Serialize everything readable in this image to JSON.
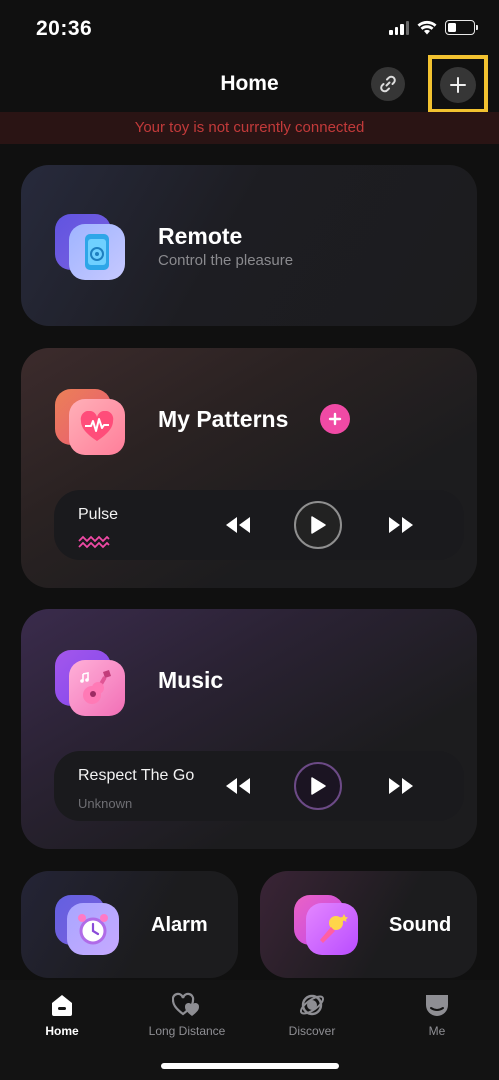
{
  "status_bar": {
    "time": "20:36"
  },
  "header": {
    "title": "Home"
  },
  "banner": {
    "text": "Your toy is not currently connected"
  },
  "cards": {
    "remote": {
      "title": "Remote",
      "subtitle": "Control the pleasure"
    },
    "patterns": {
      "title": "My Patterns",
      "player": {
        "track": "Pulse"
      }
    },
    "music": {
      "title": "Music",
      "player": {
        "track": "Respect The Go",
        "artist": "Unknown"
      }
    },
    "alarm": {
      "title": "Alarm"
    },
    "sound": {
      "title": "Sound"
    }
  },
  "tabbar": {
    "items": [
      {
        "label": "Home",
        "icon": "home-icon",
        "active": true
      },
      {
        "label": "Long Distance",
        "icon": "hearts-icon",
        "active": false
      },
      {
        "label": "Discover",
        "icon": "planet-icon",
        "active": false
      },
      {
        "label": "Me",
        "icon": "face-icon",
        "active": false
      }
    ]
  },
  "colors": {
    "accent_pink": "#f04aa5",
    "warning_red": "#c23a3a",
    "highlight_yellow": "#f2c230"
  }
}
